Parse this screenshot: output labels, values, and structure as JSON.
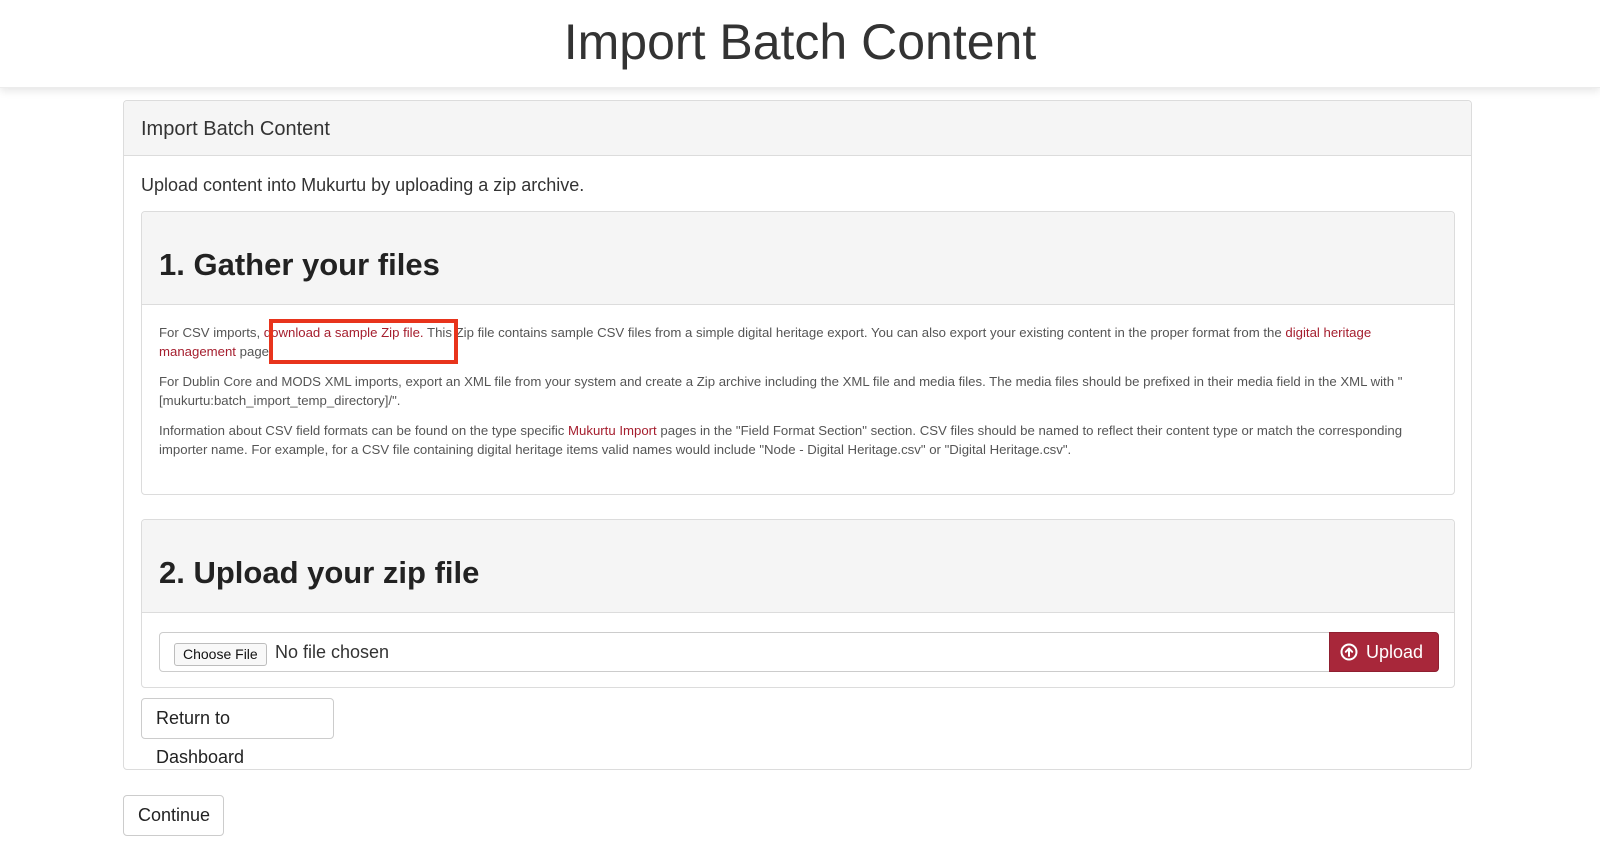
{
  "page": {
    "title": "Import Batch Content"
  },
  "panel": {
    "heading": "Import Batch Content"
  },
  "intro": "Upload content into Mukurtu by uploading a zip archive.",
  "gather": {
    "legend": "1. Gather your files",
    "p1_before": "For CSV imports, ",
    "p1_link1": "download a sample Zip file.",
    "p1_middle": " This Zip file contains sample CSV files from a simple digital heritage export. You can also export your existing content in the proper format from the ",
    "p1_link2": "digital heritage management",
    "p1_after": " page.",
    "p2": "For Dublin Core and MODS XML imports, export an XML file from your system and create a Zip archive including the XML file and media files. The media files should be prefixed in their media field in the XML with \"[mukurtu:batch_import_temp_directory]/\".",
    "p3_before": "Information about CSV field formats can be found on the type specific ",
    "p3_link": "Mukurtu Import",
    "p3_after": " pages in the \"Field Format Section\" section. CSV files should be named to reflect their content type or match the corresponding importer name. For example, for a CSV file containing digital heritage items valid names would include \"Node - Digital Heritage.csv\" or \"Digital Heritage.csv\"."
  },
  "upload": {
    "legend": "2. Upload your zip file",
    "choose_label": "Choose File",
    "file_status": "No file chosen",
    "upload_label": "Upload"
  },
  "buttons": {
    "return_label": "Return to Dashboard",
    "continue_label": "Continue"
  },
  "colors": {
    "link": "#a51e2e",
    "upload_button": "#a8273a",
    "highlight": "#e8341c"
  },
  "icons": {
    "upload": "circle-arrow-up-icon"
  }
}
